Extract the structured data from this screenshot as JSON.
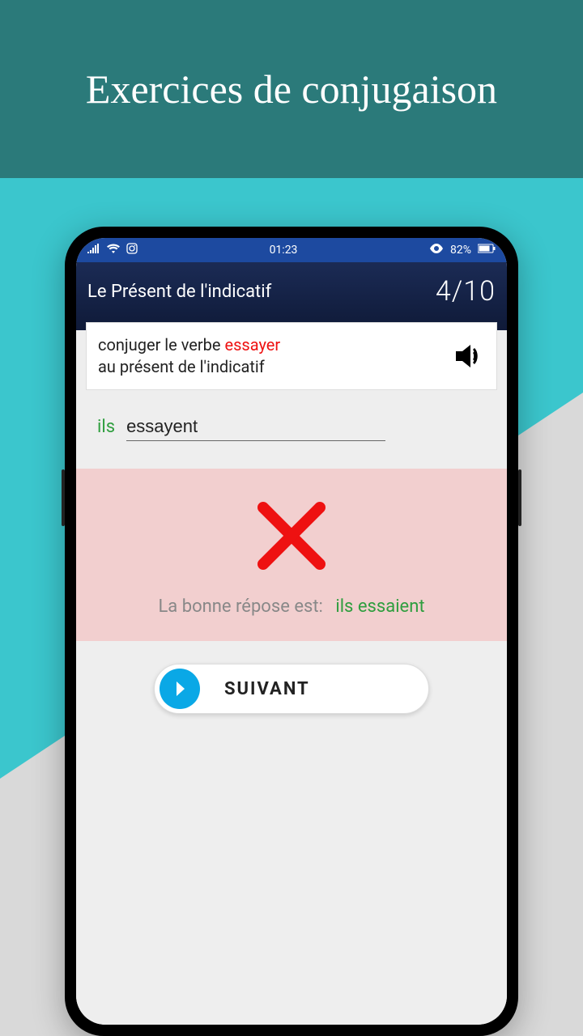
{
  "banner": {
    "title": "Exercices de conjugaison"
  },
  "statusbar": {
    "time": "01:23",
    "battery": "82%"
  },
  "header": {
    "title": "Le Présent de l'indicatif",
    "counter": "4/10"
  },
  "instruction": {
    "prefix": "conjuger le verbe ",
    "verb": "essayer",
    "suffix": "au présent de l'indicatif"
  },
  "exercise": {
    "pronoun": "ils",
    "user_answer": "essayent"
  },
  "feedback": {
    "label": "La bonne répose est:",
    "correct": "ils essaient"
  },
  "next": {
    "label": "SUIVANT"
  }
}
